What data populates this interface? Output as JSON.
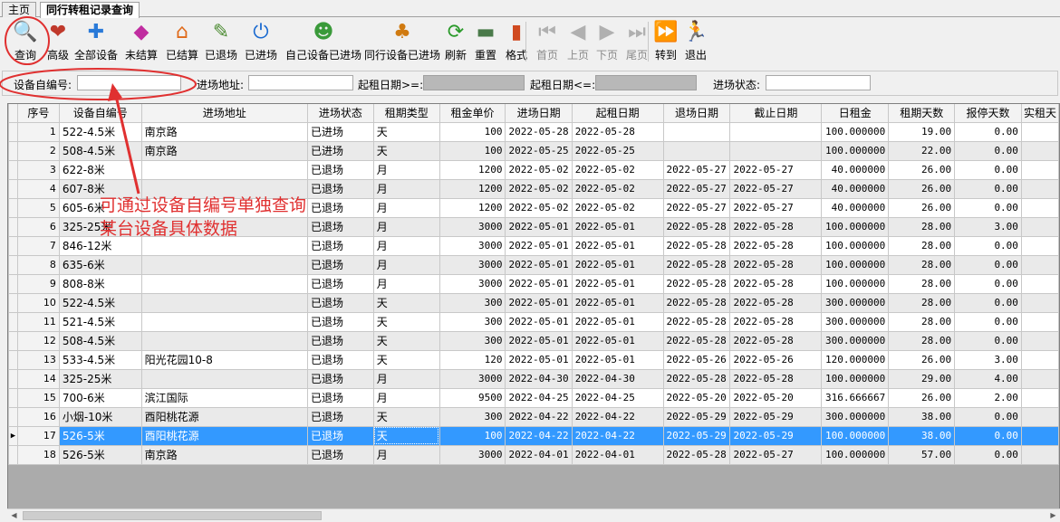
{
  "tabs": [
    {
      "label": "主页"
    },
    {
      "label": "同行转租记录查询"
    }
  ],
  "toolbar": [
    {
      "label": "查询",
      "icon": "search-icon",
      "glyph": "🔍",
      "color": "#d08a00",
      "enabled": true
    },
    {
      "label": "高级",
      "icon": "advanced-search-icon",
      "glyph": "❤",
      "color": "#c0392b",
      "enabled": true
    },
    {
      "label": "全部设备",
      "icon": "all-devices-icon",
      "glyph": "✚",
      "color": "#2a7ad8",
      "enabled": true
    },
    {
      "label": "未结算",
      "icon": "unsettled-icon",
      "glyph": "◆",
      "color": "#c02da0",
      "enabled": true
    },
    {
      "label": "已结算",
      "icon": "settled-icon",
      "glyph": "⌂",
      "color": "#e06a1a",
      "enabled": true
    },
    {
      "label": "已退场",
      "icon": "exited-icon",
      "glyph": "✎",
      "color": "#4a8a30",
      "enabled": true
    },
    {
      "label": "已进场",
      "icon": "entered-icon",
      "glyph": "⏻",
      "color": "#1a6ad0",
      "enabled": true
    },
    {
      "label": "自己设备已进场",
      "icon": "own-devices-entered-icon",
      "glyph": "☻",
      "color": "#3a9a3a",
      "enabled": true
    },
    {
      "label": "同行设备已进场",
      "icon": "peer-devices-entered-icon",
      "glyph": "♣",
      "color": "#d07a10",
      "enabled": true
    },
    {
      "label": "刷新",
      "icon": "refresh-icon",
      "glyph": "⟳",
      "color": "#2a9a2a",
      "enabled": true
    },
    {
      "label": "重置",
      "icon": "reset-icon",
      "glyph": "▬",
      "color": "#4a7a4a",
      "enabled": true
    },
    {
      "label": "格式",
      "icon": "format-icon",
      "glyph": "▮",
      "color": "#d04a20",
      "enabled": true
    },
    {
      "label": "首页",
      "icon": "first-page-icon",
      "glyph": "⏮",
      "color": "#b0b0b0",
      "enabled": false
    },
    {
      "label": "上页",
      "icon": "prev-page-icon",
      "glyph": "◀",
      "color": "#b0b0b0",
      "enabled": false
    },
    {
      "label": "下页",
      "icon": "next-page-icon",
      "glyph": "▶",
      "color": "#b0b0b0",
      "enabled": false
    },
    {
      "label": "尾页",
      "icon": "last-page-icon",
      "glyph": "⏭",
      "color": "#b0b0b0",
      "enabled": false
    },
    {
      "label": "转到",
      "icon": "goto-icon",
      "glyph": "⏩",
      "color": "#1a6ad0",
      "enabled": true
    },
    {
      "label": "退出",
      "icon": "exit-icon",
      "glyph": "🏃",
      "color": "#1a5ad0",
      "enabled": true
    }
  ],
  "filters": {
    "device_code_label": "设备自编号:",
    "device_code_value": "",
    "site_address_label": "进场地址:",
    "site_address_value": "",
    "start_date_from_label": "起租日期>=:",
    "start_date_to_label": "起租日期<=:",
    "status_label": "进场状态:",
    "status_value": ""
  },
  "grid": {
    "columns": [
      "序号",
      "设备自编号",
      "进场地址",
      "进场状态",
      "租期类型",
      "租金单价",
      "进场日期",
      "起租日期",
      "退场日期",
      "截止日期",
      "日租金",
      "租期天数",
      "报停天数",
      "实租天"
    ],
    "selected_row": 17,
    "rows": [
      [
        "1",
        "522-4.5米",
        "南京路",
        "已进场",
        "天",
        "100",
        "2022-05-28",
        "2022-05-28",
        "",
        "",
        "100.000000",
        "19.00",
        "0.00"
      ],
      [
        "2",
        "508-4.5米",
        "南京路",
        "已进场",
        "天",
        "100",
        "2022-05-25",
        "2022-05-25",
        "",
        "",
        "100.000000",
        "22.00",
        "0.00"
      ],
      [
        "3",
        "622-8米",
        "",
        "已退场",
        "月",
        "1200",
        "2022-05-02",
        "2022-05-02",
        "2022-05-27",
        "2022-05-27",
        "40.000000",
        "26.00",
        "0.00"
      ],
      [
        "4",
        "607-8米",
        "",
        "已退场",
        "月",
        "1200",
        "2022-05-02",
        "2022-05-02",
        "2022-05-27",
        "2022-05-27",
        "40.000000",
        "26.00",
        "0.00"
      ],
      [
        "5",
        "605-6米",
        "",
        "已退场",
        "月",
        "1200",
        "2022-05-02",
        "2022-05-02",
        "2022-05-27",
        "2022-05-27",
        "40.000000",
        "26.00",
        "0.00"
      ],
      [
        "6",
        "325-25米",
        "",
        "已退场",
        "月",
        "3000",
        "2022-05-01",
        "2022-05-01",
        "2022-05-28",
        "2022-05-28",
        "100.000000",
        "28.00",
        "3.00"
      ],
      [
        "7",
        "846-12米",
        "",
        "已退场",
        "月",
        "3000",
        "2022-05-01",
        "2022-05-01",
        "2022-05-28",
        "2022-05-28",
        "100.000000",
        "28.00",
        "0.00"
      ],
      [
        "8",
        "635-6米",
        "",
        "已退场",
        "月",
        "3000",
        "2022-05-01",
        "2022-05-01",
        "2022-05-28",
        "2022-05-28",
        "100.000000",
        "28.00",
        "0.00"
      ],
      [
        "9",
        "808-8米",
        "",
        "已退场",
        "月",
        "3000",
        "2022-05-01",
        "2022-05-01",
        "2022-05-28",
        "2022-05-28",
        "100.000000",
        "28.00",
        "0.00"
      ],
      [
        "10",
        "522-4.5米",
        "",
        "已退场",
        "天",
        "300",
        "2022-05-01",
        "2022-05-01",
        "2022-05-28",
        "2022-05-28",
        "300.000000",
        "28.00",
        "0.00"
      ],
      [
        "11",
        "521-4.5米",
        "",
        "已退场",
        "天",
        "300",
        "2022-05-01",
        "2022-05-01",
        "2022-05-28",
        "2022-05-28",
        "300.000000",
        "28.00",
        "0.00"
      ],
      [
        "12",
        "508-4.5米",
        "",
        "已退场",
        "天",
        "300",
        "2022-05-01",
        "2022-05-01",
        "2022-05-28",
        "2022-05-28",
        "300.000000",
        "28.00",
        "0.00"
      ],
      [
        "13",
        "533-4.5米",
        "阳光花园10-8",
        "已退场",
        "天",
        "120",
        "2022-05-01",
        "2022-05-01",
        "2022-05-26",
        "2022-05-26",
        "120.000000",
        "26.00",
        "3.00"
      ],
      [
        "14",
        "325-25米",
        "",
        "已退场",
        "月",
        "3000",
        "2022-04-30",
        "2022-04-30",
        "2022-05-28",
        "2022-05-28",
        "100.000000",
        "29.00",
        "4.00"
      ],
      [
        "15",
        "700-6米",
        "滨江国际",
        "已退场",
        "月",
        "9500",
        "2022-04-25",
        "2022-04-25",
        "2022-05-20",
        "2022-05-20",
        "316.666667",
        "26.00",
        "2.00"
      ],
      [
        "16",
        "小烟-10米",
        "酉阳桃花源",
        "已退场",
        "天",
        "300",
        "2022-04-22",
        "2022-04-22",
        "2022-05-29",
        "2022-05-29",
        "300.000000",
        "38.00",
        "0.00"
      ],
      [
        "17",
        "526-5米",
        "酉阳桃花源",
        "已退场",
        "天",
        "100",
        "2022-04-22",
        "2022-04-22",
        "2022-05-29",
        "2022-05-29",
        "100.000000",
        "38.00",
        "0.00"
      ],
      [
        "18",
        "526-5米",
        "南京路",
        "已退场",
        "月",
        "3000",
        "2022-04-01",
        "2022-04-01",
        "2022-05-28",
        "2022-05-27",
        "100.000000",
        "57.00",
        "0.00"
      ]
    ]
  },
  "annotation": {
    "line1": "可通过设备自编号单独查询",
    "line2": "某台设备具体数据",
    "color": "#e03030"
  }
}
